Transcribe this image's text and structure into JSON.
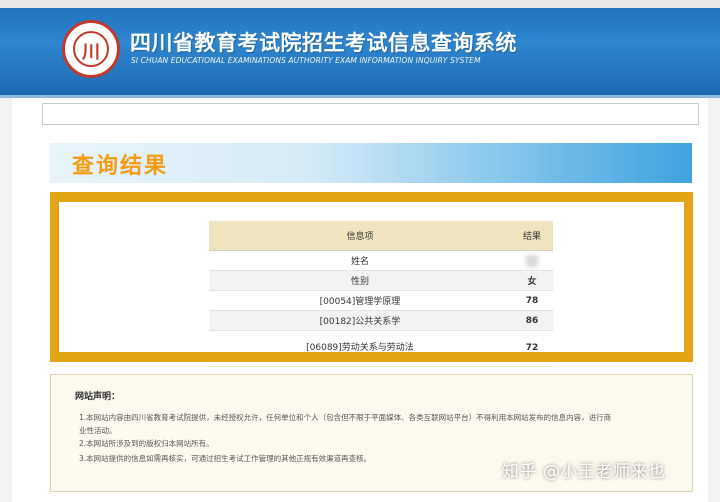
{
  "header": {
    "logo_glyph": "川",
    "title": "四川省教育考试院招生考试信息查询系统",
    "subtitle": "SI CHUAN EDUCATIONAL EXAMINATIONS AUTHORITY EXAM INFORMATION INQUIRY SYSTEM"
  },
  "result_section": {
    "title": "查询结果"
  },
  "results_table": {
    "headers": [
      "信息项",
      "结果"
    ],
    "rows": [
      {
        "label": "姓名",
        "value": ""
      },
      {
        "label": "性别",
        "value": "女"
      },
      {
        "label": "[00054]管理学原理",
        "value": "78"
      },
      {
        "label": "[00182]公共关系学",
        "value": "86"
      },
      {
        "label": "[06089]劳动关系与劳动法",
        "value": "72"
      }
    ]
  },
  "notice": {
    "title": "网站声明：",
    "lines": [
      "1.本网站内容由四川省教育考试院提供，未经授权允许，任何单位和个人（包含但不限于平面媒体、各类互联网站平台）不得利用本网站发布的信息内容，进行商",
      "业性活动。",
      "2.本网站所涉及到的版权归本网站所有。",
      "3.本网站提供的信息如需再核实，可通过招生考试工作管理的其他正规有效渠道再查核。"
    ]
  },
  "watermark": "知乎 @小王老师来也",
  "colors": {
    "header_blue": "#1f6fb8",
    "accent_orange": "#f39c12",
    "frame_gold": "#e2a516",
    "logo_red": "#c0392b"
  }
}
